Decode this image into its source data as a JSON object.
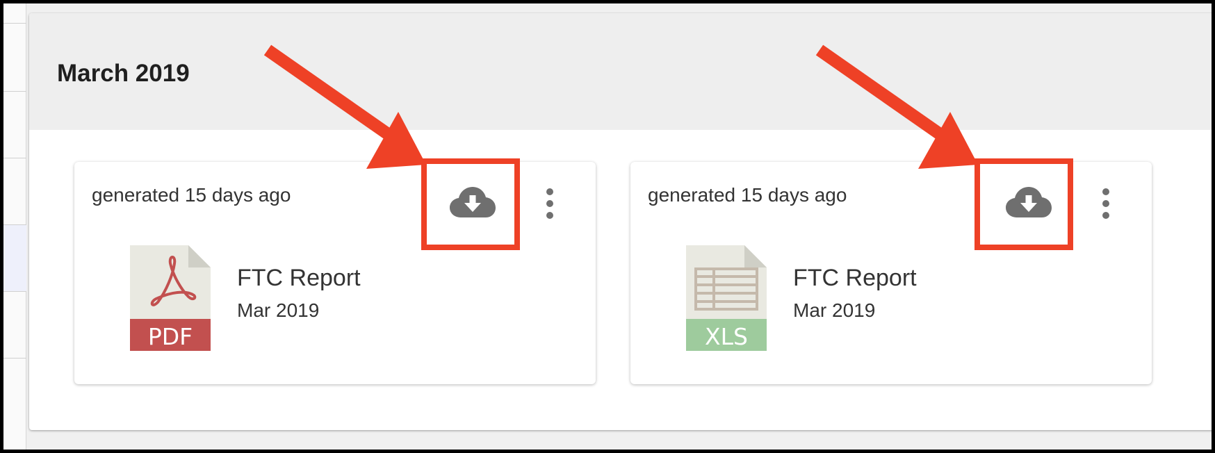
{
  "section": {
    "title": "March 2019"
  },
  "cards": [
    {
      "generated": "generated 15 days ago",
      "download_icon": "cloud-download-icon",
      "menu_icon": "more-vertical-icon",
      "file_type": "PDF",
      "file_icon": "pdf-file-icon",
      "report_name": "FTC Report",
      "report_date": "Mar 2019"
    },
    {
      "generated": "generated 15 days ago",
      "download_icon": "cloud-download-icon",
      "menu_icon": "more-vertical-icon",
      "file_type": "XLS",
      "file_icon": "xls-file-icon",
      "report_name": "FTC Report",
      "report_date": "Mar 2019"
    }
  ],
  "colors": {
    "annotation": "#ee4126",
    "pdf_band": "#c2504f",
    "xls_band": "#9ecb9d",
    "icon_gray": "#6f6f6f",
    "header_bg": "#eeeeee"
  }
}
